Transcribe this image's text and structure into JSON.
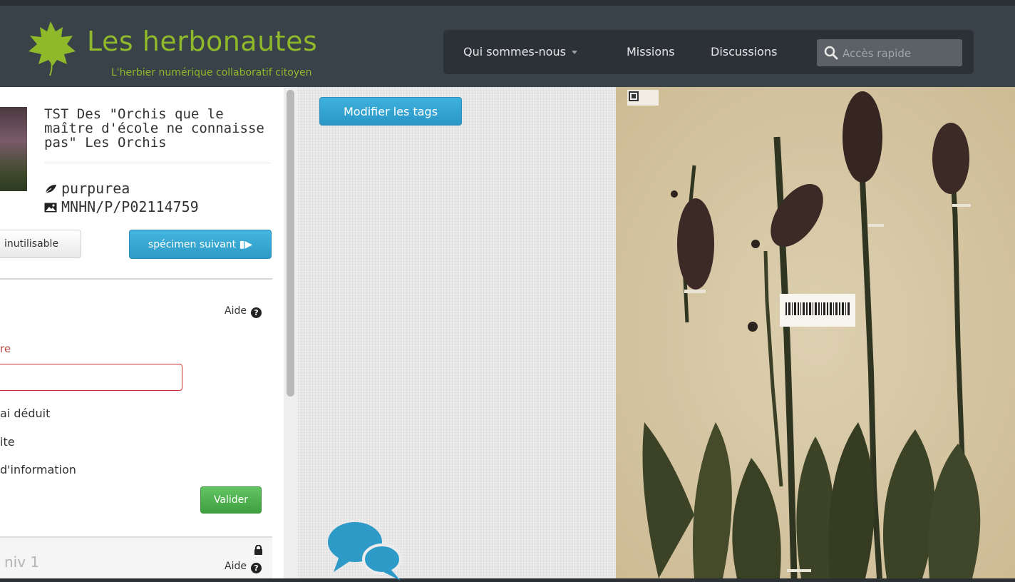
{
  "header": {
    "title": "Les herbonautes",
    "subtitle": "L'herbier numérique collaboratif citoyen"
  },
  "nav": {
    "items": [
      {
        "label": "Qui sommes-nous"
      },
      {
        "label": "Missions"
      },
      {
        "label": "Discussions"
      }
    ],
    "search_placeholder": "Accès rapide"
  },
  "sidebar": {
    "specimen_title": "TST Des \"Orchis que le maître d'école ne connaisse pas\" Les Orchis",
    "species": "purpurea",
    "catalog_number": "MNHN/P/P02114759",
    "btn_unusable": "inutilisable",
    "btn_next": "spécimen suivant",
    "help": "Aide",
    "field_label": "re",
    "options": [
      "ai déduit",
      "ite",
      "d'information"
    ],
    "btn_validate": "Valider",
    "level_label": "niv 1",
    "level_help": "Aide"
  },
  "center": {
    "btn_tags": "Modifier les tags"
  },
  "colors": {
    "header_bg": "#394149",
    "brand_green": "#8fb82a",
    "button_blue": "#2e9ac7",
    "button_green": "#3fa03f",
    "error_red": "#c9302c"
  }
}
